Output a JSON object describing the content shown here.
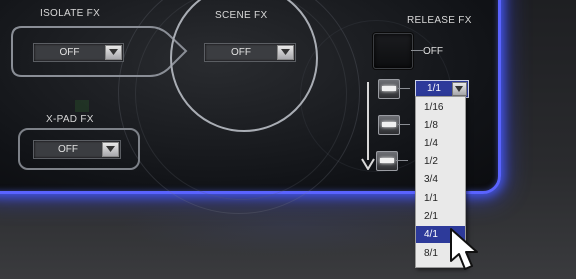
{
  "isolate_fx": {
    "label": "ISOLATE FX",
    "value": "OFF"
  },
  "scene_fx": {
    "label": "SCENE FX",
    "value": "OFF"
  },
  "xpad_fx": {
    "label": "X-PAD FX",
    "value": "OFF"
  },
  "release_fx": {
    "label": "RELEASE FX",
    "button_label": "OFF",
    "selected_value": "1/1",
    "options": [
      "1/16",
      "1/8",
      "1/4",
      "1/2",
      "3/4",
      "1/1",
      "2/1",
      "4/1",
      "8/1"
    ],
    "highlighted": "4/1"
  },
  "colors": {
    "accent": "#5a63ff",
    "selection": "#2d3a9a",
    "dropdown_bg": "#e9e9e9"
  }
}
